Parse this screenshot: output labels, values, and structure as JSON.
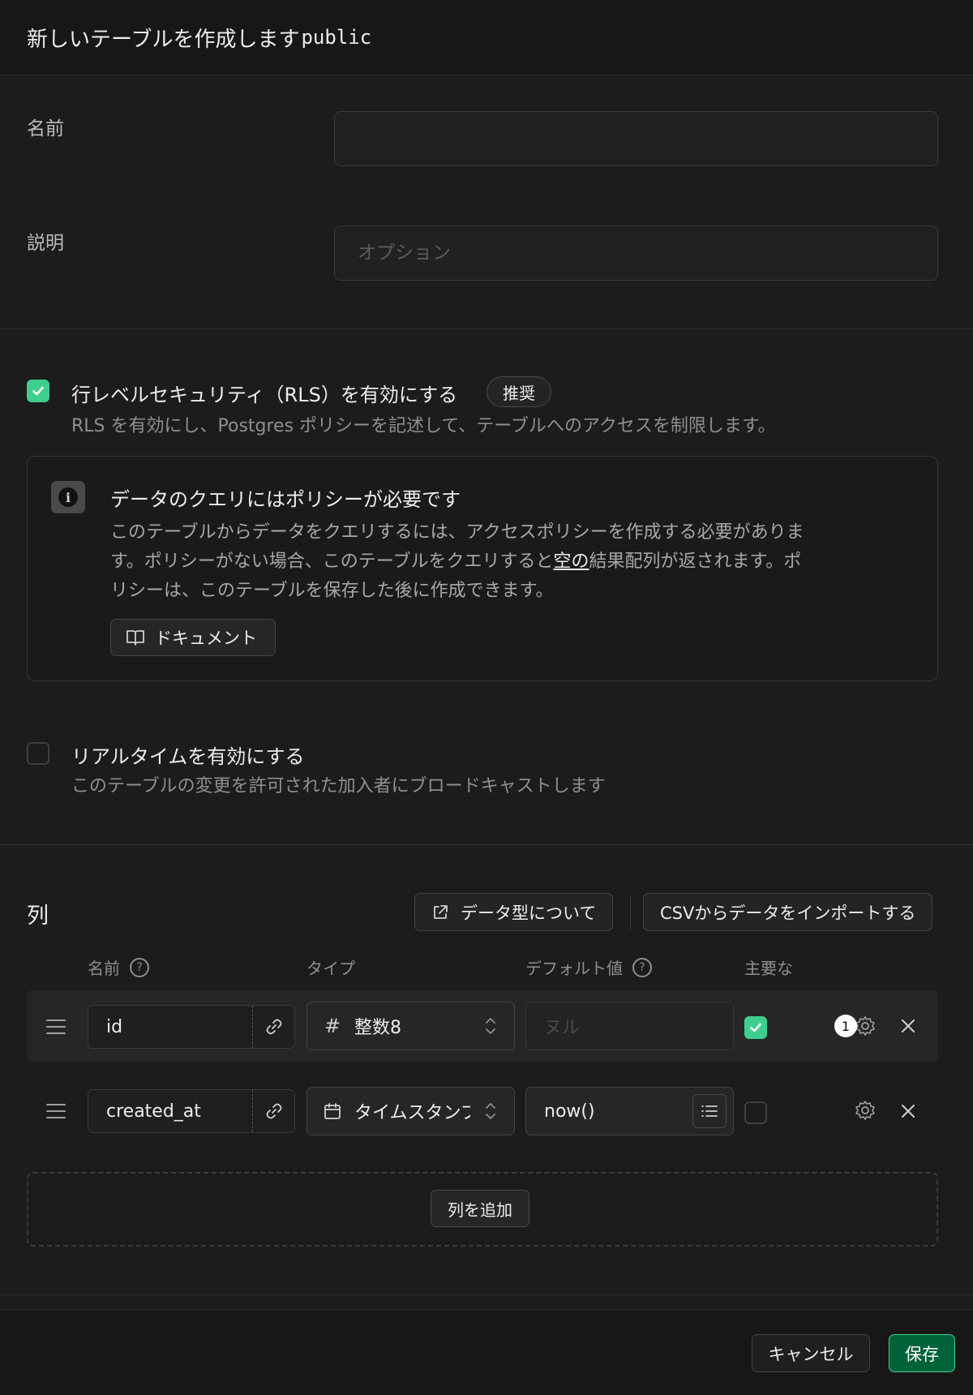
{
  "header": {
    "title": "新しいテーブルを作成します",
    "schema": "public"
  },
  "form": {
    "name_label": "名前",
    "name_value": "",
    "description_label": "説明",
    "description_placeholder": "オプション"
  },
  "rls": {
    "checked": true,
    "title": "行レベルセキュリティ（RLS）を有効にする",
    "badge": "推奨",
    "description": "RLS を有効にし、Postgres ポリシーを記述して、テーブルへのアクセスを制限します。"
  },
  "info": {
    "title": "データのクエリにはポリシーが必要です",
    "body_line1": "このテーブルからデータをクエリするには、アクセスポリシーを作成する必要がありま",
    "body_line2_a": "す。ポリシーがない場合、このテーブルをクエリすると",
    "body_line2_link": "空の",
    "body_line2_b": "結果配列が返されます。ポ",
    "body_line3": "リシーは、このテーブルを保存した後に作成できます。",
    "docs_button": "ドキュメント"
  },
  "realtime": {
    "checked": false,
    "title": "リアルタイムを有効にする",
    "description": "このテーブルの変更を許可された加入者にブロードキャストします"
  },
  "columns": {
    "section_title": "列",
    "data_types_button": "データ型について",
    "import_csv_button": "CSVからデータをインポートする",
    "headers": {
      "name": "名前",
      "type": "タイプ",
      "default": "デフォルト値",
      "primary": "主要な"
    },
    "help_glyph": "?",
    "rows": [
      {
        "name": "id",
        "type_icon": "hash-icon",
        "type_glyph": "#",
        "type": "整数8",
        "default": "",
        "default_placeholder": "ヌル",
        "primary": true,
        "badge": "1"
      },
      {
        "name": "created_at",
        "type_icon": "calendar-icon",
        "type": "タイムスタンプ",
        "default": "now()",
        "default_placeholder": "",
        "primary": false
      }
    ],
    "add_button": "列を追加"
  },
  "footer": {
    "cancel": "キャンセル",
    "save": "保存"
  },
  "colors": {
    "accent": "#3ecf8e",
    "save_bg": "#006239",
    "background": "#1c1c1c"
  }
}
